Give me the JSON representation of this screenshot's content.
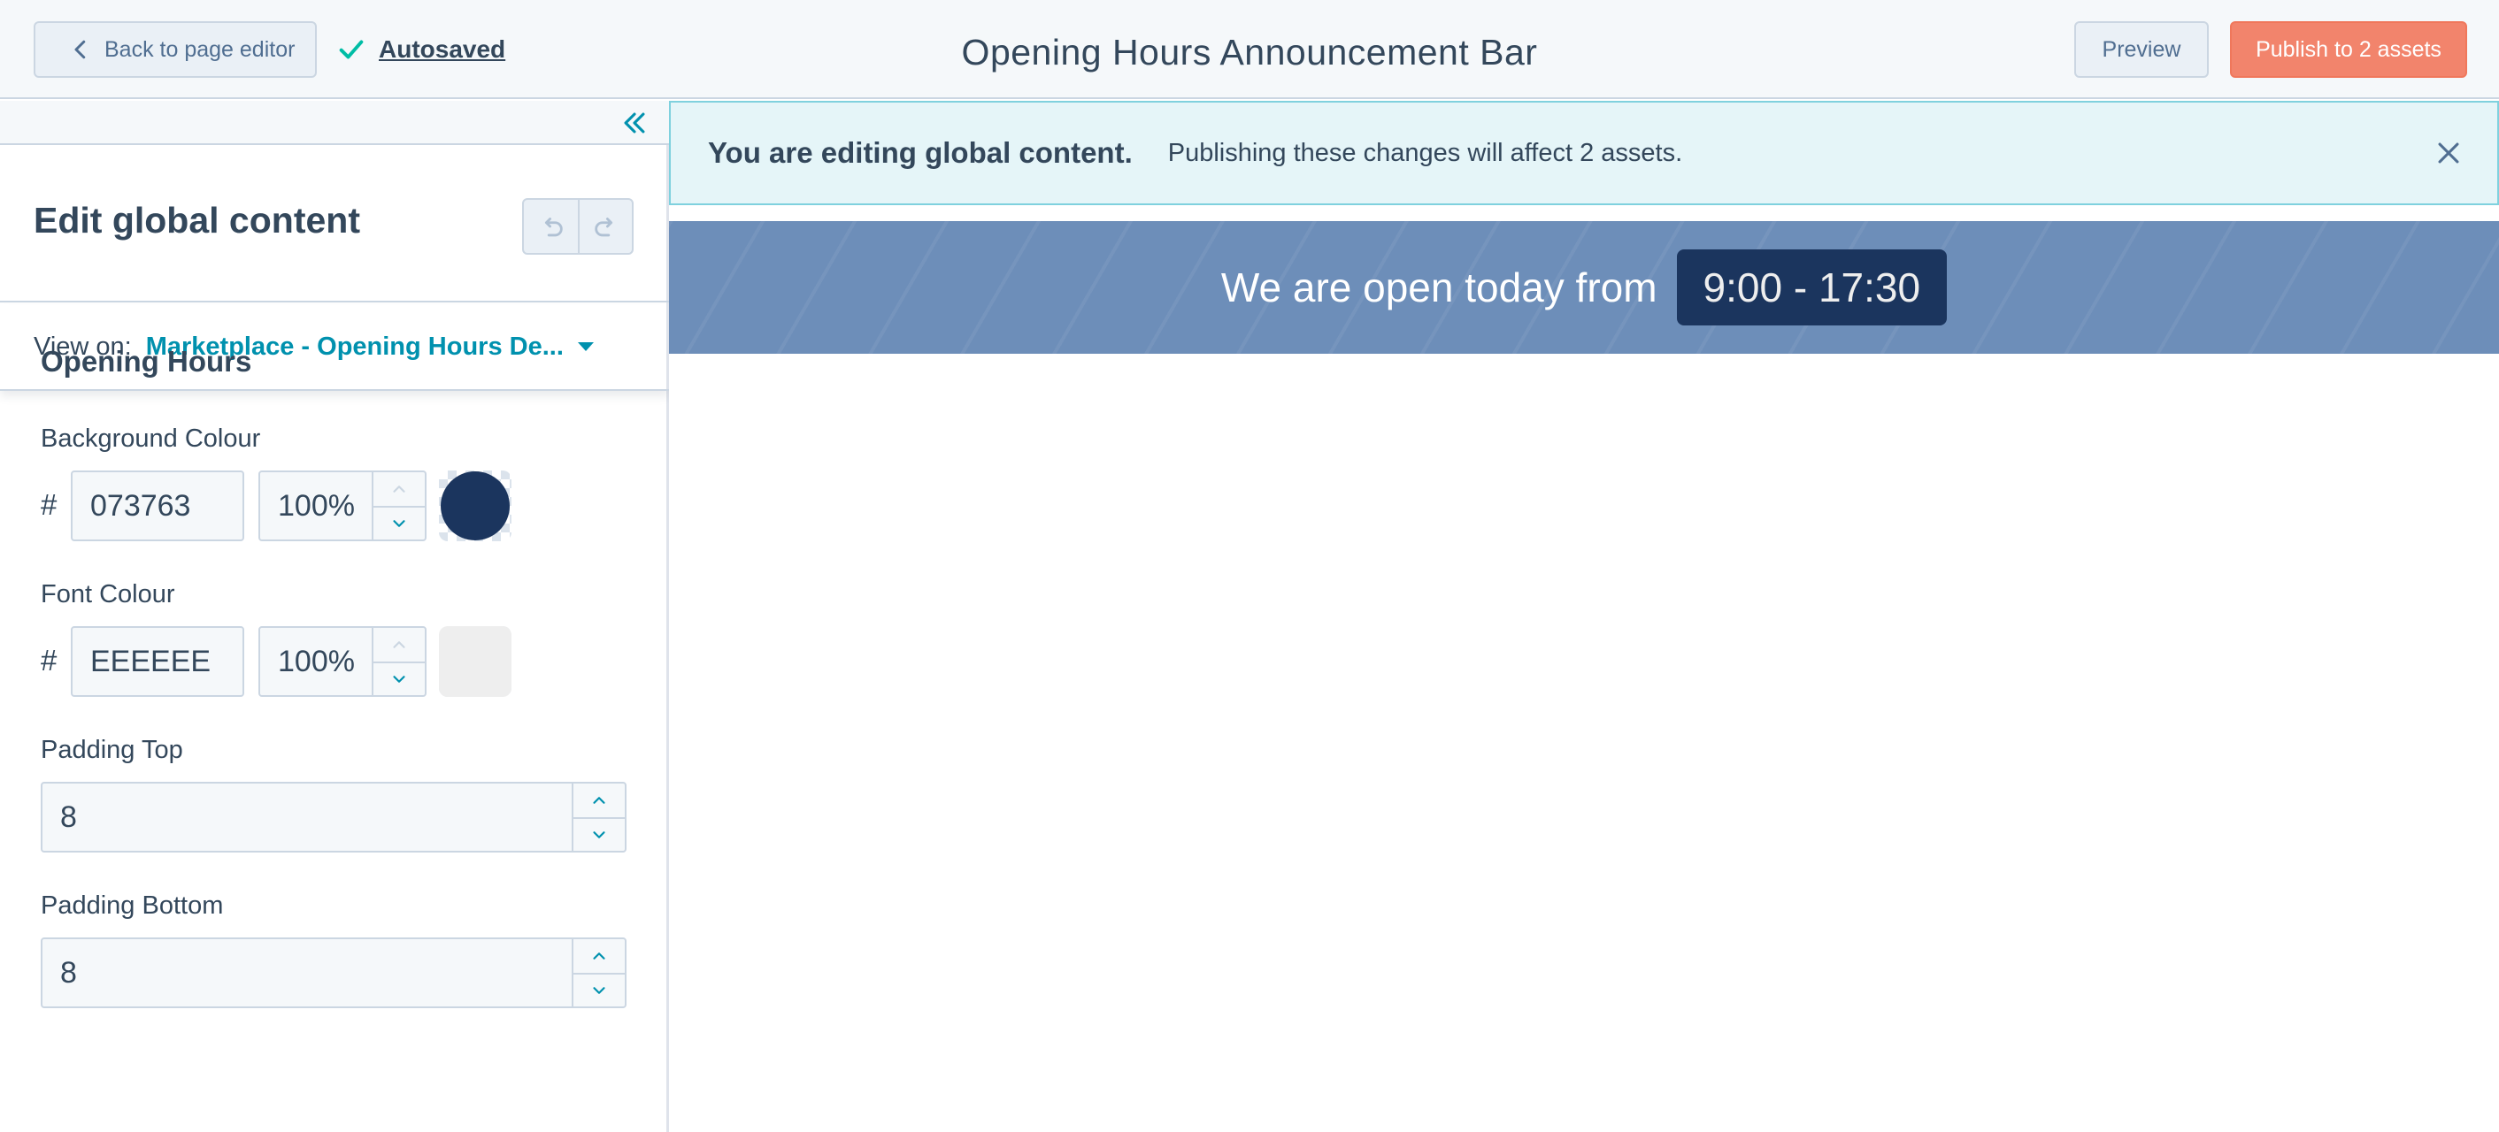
{
  "topbar": {
    "back_label": "Back to page editor",
    "autosaved_label": "Autosaved",
    "title": "Opening Hours Announcement Bar",
    "preview_label": "Preview",
    "publish_label": "Publish to 2 assets"
  },
  "sidebar": {
    "edit_title": "Edit global content",
    "view_on_label": "View on:",
    "view_on_value": "Marketplace - Opening Hours De...",
    "section_title": "Opening Hours",
    "background_colour": {
      "label": "Background Colour",
      "hash": "#",
      "hex": "073763",
      "opacity": "100%",
      "swatch_color": "#1b355e"
    },
    "font_colour": {
      "label": "Font Colour",
      "hash": "#",
      "hex": "EEEEEE",
      "opacity": "100%",
      "swatch_color": "#eeeeee"
    },
    "padding_top": {
      "label": "Padding Top",
      "value": "8"
    },
    "padding_bottom": {
      "label": "Padding Bottom",
      "value": "8"
    }
  },
  "preview": {
    "banner_strong": "You are editing global content.",
    "banner_message": "Publishing these changes will affect 2 assets.",
    "announcement_text": "We are open today from",
    "announcement_hours": "9:00 - 17:30"
  },
  "colors": {
    "accent": "#0091ae",
    "publish": "#f2846c",
    "bar_background": "#6d8eb9",
    "hours_background": "#1b355e"
  }
}
